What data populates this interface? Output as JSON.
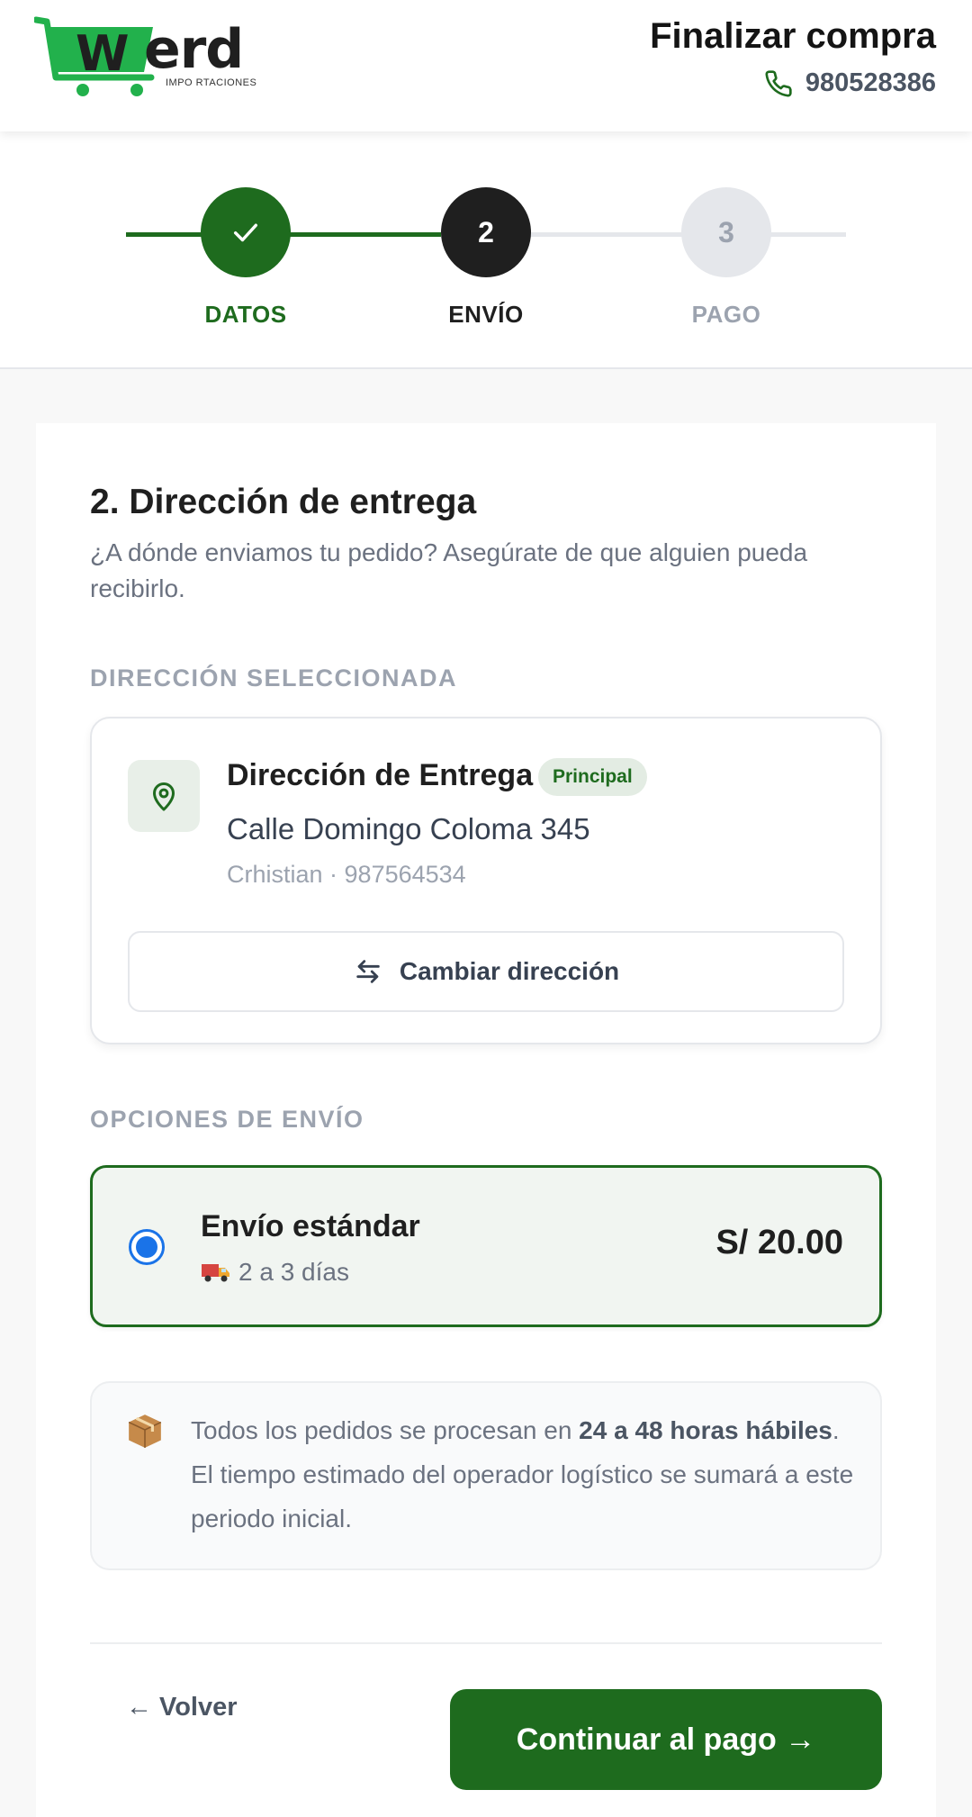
{
  "header": {
    "logo_text": "erd",
    "logo_letter": "W",
    "logo_subtitle": "IMPO RTACIONES",
    "title": "Finalizar compra",
    "phone": "980528386"
  },
  "stepper": {
    "steps": [
      {
        "number": "",
        "label": "DATOS",
        "state": "completed"
      },
      {
        "number": "2",
        "label": "ENVÍO",
        "state": "active"
      },
      {
        "number": "3",
        "label": "PAGO",
        "state": "pending"
      }
    ]
  },
  "delivery": {
    "title": "2. Dirección de entrega",
    "subtitle": "¿A dónde enviamos tu pedido? Asegúrate de que alguien pueda recibirlo.",
    "selected_label": "DIRECCIÓN SELECCIONADA",
    "address": {
      "title": "Dirección de Entrega",
      "badge": "Principal",
      "street": "Calle Domingo Coloma 345",
      "contact": "Crhistian · 987564534",
      "change_label": "Cambiar dirección"
    }
  },
  "shipping": {
    "label": "OPCIONES DE ENVÍO",
    "option": {
      "name": "Envío estándar",
      "days": "2 a 3 días",
      "price": "S/ 20.00",
      "selected": true
    }
  },
  "info": {
    "text_before": "Todos los pedidos se procesan en ",
    "text_bold": "24 a 48 horas hábiles",
    "text_after": ". El tiempo estimado del operador logístico se sumará a este periodo inicial."
  },
  "actions": {
    "back_label": "Volver",
    "back_arrow": "←",
    "continue_label": "Continuar al pago →"
  },
  "colors": {
    "primary_green": "#1e6b1e",
    "logo_green": "#22b14c",
    "radio_blue": "#1a73e8",
    "dark_step": "#1f1f1f"
  }
}
